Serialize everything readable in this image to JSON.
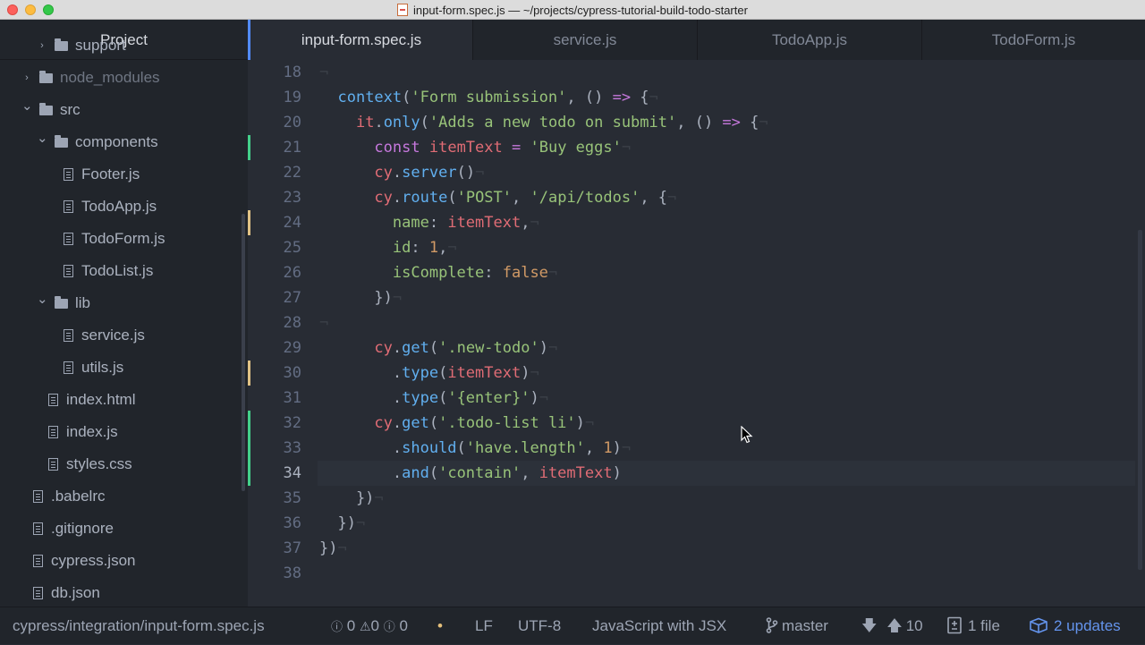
{
  "window": {
    "title": "input-form.spec.js — ~/projects/cypress-tutorial-build-todo-starter"
  },
  "sidebar": {
    "header": "Project",
    "items": [
      {
        "label": "support",
        "type": "folder",
        "depth": 1,
        "state": "collapsed"
      },
      {
        "label": "node_modules",
        "type": "folder",
        "depth": 0,
        "state": "collapsed",
        "dimmed": true
      },
      {
        "label": "src",
        "type": "folder",
        "depth": 0,
        "state": "expanded"
      },
      {
        "label": "components",
        "type": "folder",
        "depth": 1,
        "state": "expanded"
      },
      {
        "label": "Footer.js",
        "type": "file",
        "depth": 2
      },
      {
        "label": "TodoApp.js",
        "type": "file",
        "depth": 2
      },
      {
        "label": "TodoForm.js",
        "type": "file",
        "depth": 2
      },
      {
        "label": "TodoList.js",
        "type": "file",
        "depth": 2
      },
      {
        "label": "lib",
        "type": "folder",
        "depth": 1,
        "state": "expanded"
      },
      {
        "label": "service.js",
        "type": "file",
        "depth": 2
      },
      {
        "label": "utils.js",
        "type": "file",
        "depth": 2
      },
      {
        "label": "index.html",
        "type": "file",
        "depth": 1
      },
      {
        "label": "index.js",
        "type": "file",
        "depth": 1
      },
      {
        "label": "styles.css",
        "type": "file",
        "depth": 1
      },
      {
        "label": ".babelrc",
        "type": "file",
        "depth": 0
      },
      {
        "label": ".gitignore",
        "type": "file",
        "depth": 0
      },
      {
        "label": "cypress.json",
        "type": "file",
        "depth": 0
      },
      {
        "label": "db.json",
        "type": "file",
        "depth": 0
      }
    ]
  },
  "tabs": [
    {
      "label": "input-form.spec.js",
      "active": true
    },
    {
      "label": "service.js",
      "active": false
    },
    {
      "label": "TodoApp.js",
      "active": false
    },
    {
      "label": "TodoForm.js",
      "active": false
    }
  ],
  "editor": {
    "current_line": 34,
    "lines": [
      {
        "n": "18",
        "tokens": [
          [
            "inv",
            "¬"
          ]
        ]
      },
      {
        "n": "19",
        "tokens": [
          [
            "pl",
            "  "
          ],
          [
            "fn",
            "context"
          ],
          [
            "pl",
            "("
          ],
          [
            "str",
            "'Form submission'"
          ],
          [
            "pl",
            ", () "
          ],
          [
            "kw",
            "=>"
          ],
          [
            "pl",
            " {"
          ],
          [
            "inv",
            "¬"
          ]
        ]
      },
      {
        "n": "20",
        "tokens": [
          [
            "pl",
            "    "
          ],
          [
            "var",
            "it"
          ],
          [
            "pl",
            "."
          ],
          [
            "fn",
            "only"
          ],
          [
            "pl",
            "("
          ],
          [
            "str",
            "'Adds a new todo on submit'"
          ],
          [
            "pl",
            ", () "
          ],
          [
            "kw",
            "=>"
          ],
          [
            "pl",
            " {"
          ],
          [
            "inv",
            "¬"
          ]
        ]
      },
      {
        "n": "21",
        "tokens": [
          [
            "pl",
            "      "
          ],
          [
            "kw",
            "const"
          ],
          [
            "pl",
            " "
          ],
          [
            "var",
            "itemText"
          ],
          [
            "pl",
            " "
          ],
          [
            "kw",
            "="
          ],
          [
            "pl",
            " "
          ],
          [
            "str",
            "'Buy eggs'"
          ],
          [
            "inv",
            "¬"
          ]
        ]
      },
      {
        "n": "22",
        "tokens": [
          [
            "pl",
            "      "
          ],
          [
            "var",
            "cy"
          ],
          [
            "pl",
            "."
          ],
          [
            "fn",
            "server"
          ],
          [
            "pl",
            "()"
          ],
          [
            "inv",
            "¬"
          ]
        ]
      },
      {
        "n": "23",
        "tokens": [
          [
            "pl",
            "      "
          ],
          [
            "var",
            "cy"
          ],
          [
            "pl",
            "."
          ],
          [
            "fn",
            "route"
          ],
          [
            "pl",
            "("
          ],
          [
            "str",
            "'POST'"
          ],
          [
            "pl",
            ", "
          ],
          [
            "str",
            "'/api/todos'"
          ],
          [
            "pl",
            ", {"
          ],
          [
            "inv",
            "¬"
          ]
        ]
      },
      {
        "n": "24",
        "tokens": [
          [
            "pl",
            "        "
          ],
          [
            "str",
            "name"
          ],
          [
            "pl",
            ": "
          ],
          [
            "var",
            "itemText"
          ],
          [
            "pl",
            ","
          ],
          [
            "inv",
            "¬"
          ]
        ]
      },
      {
        "n": "25",
        "tokens": [
          [
            "pl",
            "        "
          ],
          [
            "str",
            "id"
          ],
          [
            "pl",
            ": "
          ],
          [
            "num",
            "1"
          ],
          [
            "pl",
            ","
          ],
          [
            "inv",
            "¬"
          ]
        ]
      },
      {
        "n": "26",
        "tokens": [
          [
            "pl",
            "        "
          ],
          [
            "str",
            "isComplete"
          ],
          [
            "pl",
            ": "
          ],
          [
            "num",
            "false"
          ],
          [
            "inv",
            "¬"
          ]
        ]
      },
      {
        "n": "27",
        "tokens": [
          [
            "pl",
            "      })"
          ],
          [
            "inv",
            "¬"
          ]
        ]
      },
      {
        "n": "28",
        "tokens": [
          [
            "inv",
            "¬"
          ]
        ]
      },
      {
        "n": "29",
        "tokens": [
          [
            "pl",
            "      "
          ],
          [
            "var",
            "cy"
          ],
          [
            "pl",
            "."
          ],
          [
            "fn",
            "get"
          ],
          [
            "pl",
            "("
          ],
          [
            "str",
            "'.new-todo'"
          ],
          [
            "pl",
            ")"
          ],
          [
            "inv",
            "¬"
          ]
        ]
      },
      {
        "n": "30",
        "tokens": [
          [
            "pl",
            "        ."
          ],
          [
            "fn",
            "type"
          ],
          [
            "pl",
            "("
          ],
          [
            "var",
            "itemText"
          ],
          [
            "pl",
            ")"
          ],
          [
            "inv",
            "¬"
          ]
        ]
      },
      {
        "n": "31",
        "tokens": [
          [
            "pl",
            "        ."
          ],
          [
            "fn",
            "type"
          ],
          [
            "pl",
            "("
          ],
          [
            "str",
            "'{enter}'"
          ],
          [
            "pl",
            ")"
          ],
          [
            "inv",
            "¬"
          ]
        ]
      },
      {
        "n": "32",
        "tokens": [
          [
            "pl",
            "      "
          ],
          [
            "var",
            "cy"
          ],
          [
            "pl",
            "."
          ],
          [
            "fn",
            "get"
          ],
          [
            "pl",
            "("
          ],
          [
            "str",
            "'.todo-list li'"
          ],
          [
            "pl",
            ")"
          ],
          [
            "inv",
            "¬"
          ]
        ]
      },
      {
        "n": "33",
        "tokens": [
          [
            "pl",
            "        ."
          ],
          [
            "fn",
            "should"
          ],
          [
            "pl",
            "("
          ],
          [
            "str",
            "'have.length'"
          ],
          [
            "pl",
            ", "
          ],
          [
            "num",
            "1"
          ],
          [
            "pl",
            ")"
          ],
          [
            "inv",
            "¬"
          ]
        ]
      },
      {
        "n": "34",
        "tokens": [
          [
            "pl",
            "        ."
          ],
          [
            "fn",
            "and"
          ],
          [
            "pl",
            "("
          ],
          [
            "str",
            "'contain'"
          ],
          [
            "pl",
            ", "
          ],
          [
            "var",
            "itemText"
          ],
          [
            "pl",
            ")"
          ]
        ]
      },
      {
        "n": "35",
        "tokens": [
          [
            "pl",
            "    })"
          ],
          [
            "inv",
            "¬"
          ]
        ]
      },
      {
        "n": "36",
        "tokens": [
          [
            "pl",
            "  })"
          ],
          [
            "inv",
            "¬"
          ]
        ]
      },
      {
        "n": "37",
        "tokens": [
          [
            "pl",
            "})"
          ],
          [
            "inv",
            "¬"
          ]
        ]
      },
      {
        "n": "38",
        "tokens": []
      }
    ],
    "git_gutter": {
      "added": [
        21,
        32,
        33,
        34
      ],
      "modified": [
        24,
        30
      ]
    }
  },
  "statusbar": {
    "file_path": "cypress/integration/input-form.spec.js",
    "errors": "0",
    "warnings": "0",
    "infos": "0",
    "line_ending": "LF",
    "encoding": "UTF-8",
    "grammar": "JavaScript with JSX",
    "branch": "master",
    "behind": "",
    "ahead": "10",
    "changed_files": "1 file",
    "updates": "2 updates"
  },
  "colors": {
    "accent": "#528bff",
    "git_added": "#43d08a",
    "git_modified": "#e0c285",
    "updates": "#6494ed"
  },
  "icons": {
    "title_file": "js-file-icon",
    "folder": "folder-icon",
    "file": "file-text-icon",
    "branch": "git-branch-icon",
    "changes": "file-diff-icon",
    "updates": "package-icon"
  }
}
